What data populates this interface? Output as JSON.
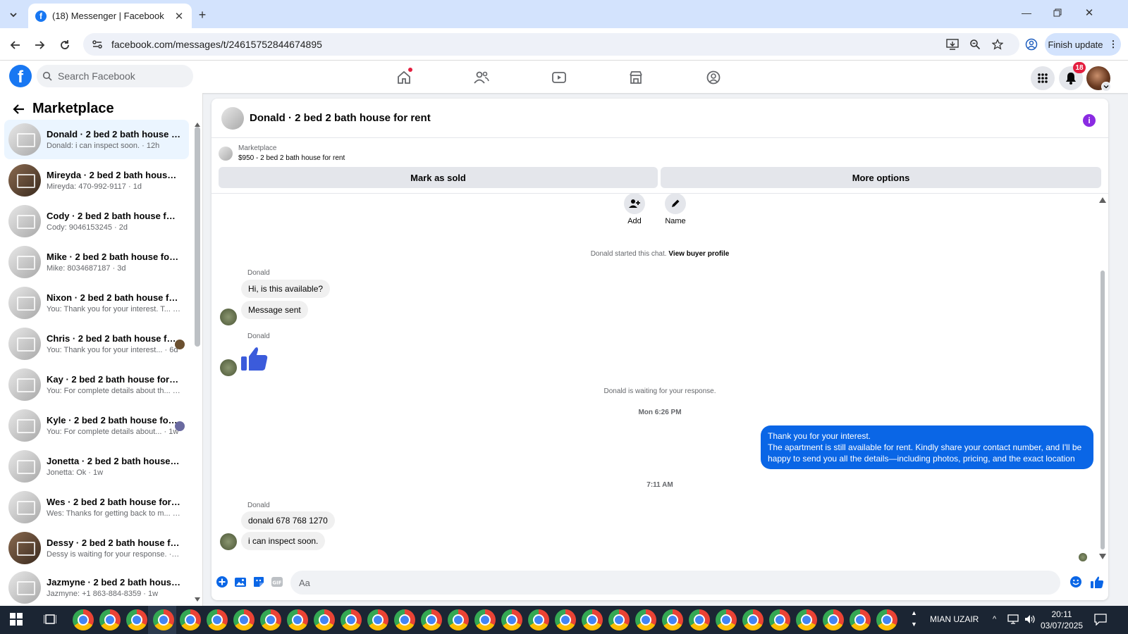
{
  "browser": {
    "tab_title": "(18) Messenger | Facebook",
    "url": "facebook.com/messages/t/24615752844674895",
    "finish_update": "Finish update"
  },
  "fb": {
    "search_placeholder": "Search Facebook",
    "notification_count": "18",
    "logo": "f"
  },
  "sidebar": {
    "title": "Marketplace",
    "conversations": [
      {
        "name": "Donald · 2 bed 2 bath house for...",
        "snippet": "Donald: i can inspect soon. · 12h"
      },
      {
        "name": "Mireyda · 2 bed 2 bath house fo...",
        "snippet": "Mireyda: 470-992-9117 · 1d"
      },
      {
        "name": "Cody · 2 bed 2 bath house for r...",
        "snippet": "Cody: 9046153245 · 2d"
      },
      {
        "name": "Mike · 2 bed 2 bath house for r...",
        "snippet": "Mike: 8034687187 · 3d"
      },
      {
        "name": "Nixon · 2 bed 2 bath house for r...",
        "snippet": "You: Thank you for your interest. T... · 6d"
      },
      {
        "name": "Chris · 2 bed 2 bath house for...",
        "snippet": "You: Thank you for your interest... · 6d"
      },
      {
        "name": "Kay · 2 bed 2 bath house for rent",
        "snippet": "You: For complete details about th... · 1w"
      },
      {
        "name": "Kyle · 2 bed 2 bath house for ...",
        "snippet": "You: For complete details about... · 1w"
      },
      {
        "name": "Jonetta · 2 bed 2 bath house for...",
        "snippet": "Jonetta: Ok · 1w"
      },
      {
        "name": "Wes · 2 bed 2 bath house for rent",
        "snippet": "Wes: Thanks for getting back to m... · 1w"
      },
      {
        "name": "Dessy · 2 bed 2 bath house for r...",
        "snippet": "Dessy is waiting for your response. · 1w"
      },
      {
        "name": "Jazmyne · 2 bed 2 bath house f...",
        "snippet": "Jazmyne: +1 863-884-8359 · 1w"
      }
    ]
  },
  "chat": {
    "title": "Donald · 2 bed 2 bath house for rent",
    "info_glyph": "i",
    "listing_category": "Marketplace",
    "listing_price": "$950 - 2 bed 2 bath house for rent",
    "mark_sold": "Mark as sold",
    "more_options": "More options",
    "tool_add": "Add",
    "tool_name": "Name",
    "started": "Donald started this chat.",
    "view_buyer": "View buyer profile",
    "sender": "Donald",
    "msg1": "Hi, is this available?",
    "msg2": "Message sent",
    "waiting": "Donald is waiting for your response.",
    "time1": "Mon 6:26 PM",
    "mine_line1": "Thank you for your interest.",
    "mine_line2": "The apartment is still available for rent. Kindly share your contact number, and I'll be happy to send you all the details—including photos, pricing, and the exact location",
    "time2": "7:11 AM",
    "msg3": "donald   678 768 1270",
    "msg4": "i can inspect   soon.",
    "composer_placeholder": "Aa"
  },
  "taskbar": {
    "user": "MIAN UZAIR",
    "time": "20:11",
    "date": "03/07/2025"
  },
  "colors": {
    "facebook_blue": "#1877f2",
    "my_bubble": "#0a66e6",
    "like_blue": "#3b5bdb",
    "notif_red": "#e41e3f"
  }
}
